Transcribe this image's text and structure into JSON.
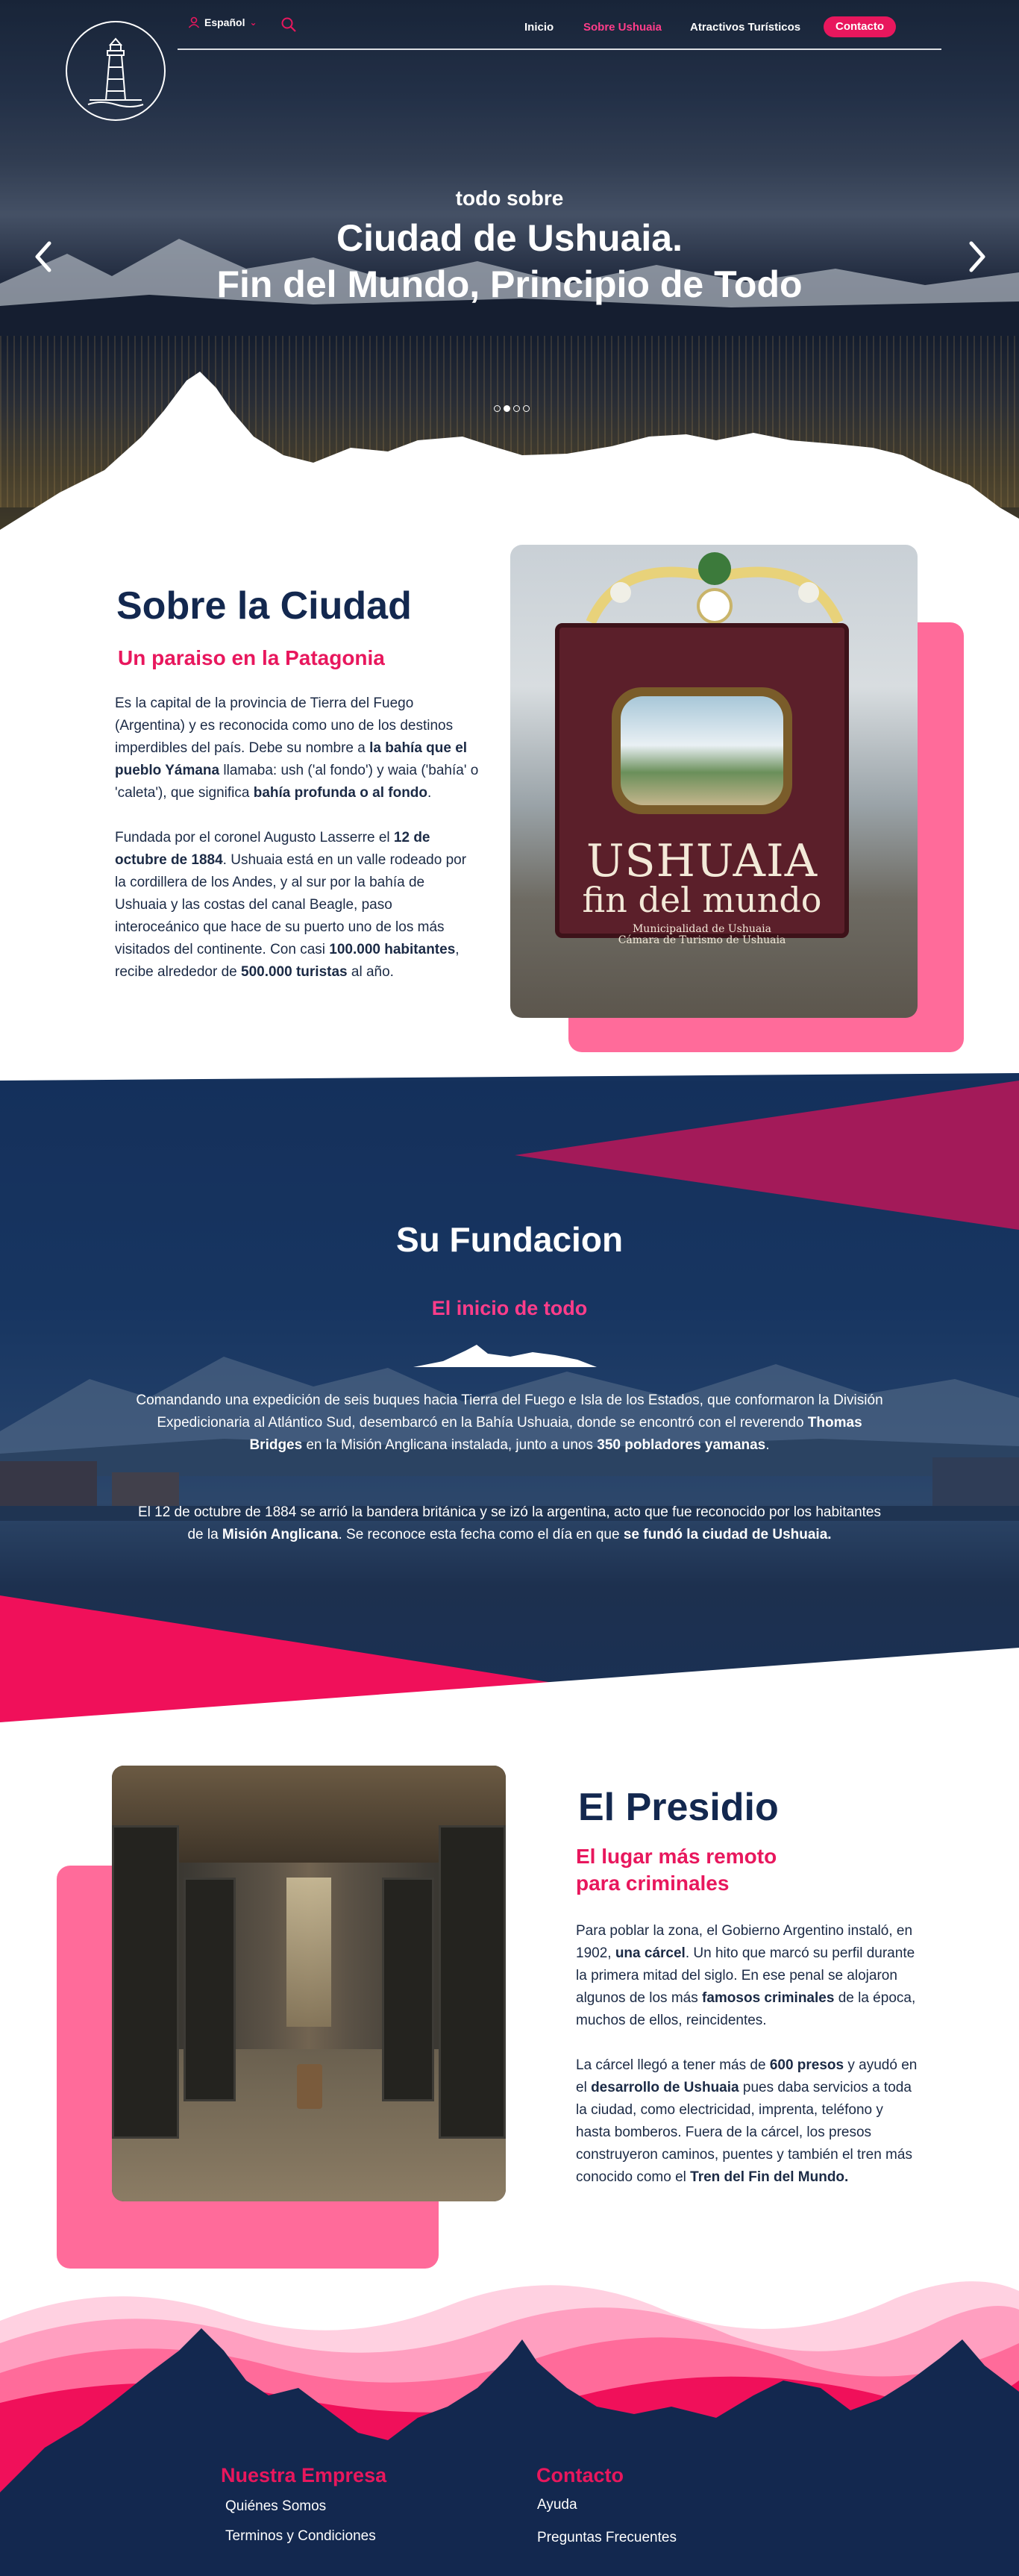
{
  "header": {
    "language": "Español",
    "nav": [
      "Inicio",
      "Sobre Ushuaia",
      "Atractivos Turísticos",
      "Contacto"
    ],
    "active_nav": "Sobre Ushuaia"
  },
  "hero": {
    "kicker": "todo sobre",
    "title_line1": "Ciudad de Ushuaia.",
    "title_line2": "Fin del Mundo, Principio de Todo",
    "slides": 4,
    "active_slide": 2
  },
  "sobre": {
    "title": "Sobre la Ciudad",
    "subtitle": "Un paraiso en la Patagonia",
    "p1": [
      {
        "t": "Es la capital de la provincia de Tierra del Fuego (Argentina) y es reconocida como uno de los destinos imperdibles del país. Debe su nombre a "
      },
      {
        "t": "la bahía que el pueblo Yámana",
        "b": true
      },
      {
        "t": " llamaba: ush ('al fondo') y waia ('bahía' o 'caleta'), que significa "
      },
      {
        "t": "bahía profunda o al fondo",
        "b": true
      },
      {
        "t": "."
      }
    ],
    "p2": [
      {
        "t": "Fundada por el coronel Augusto Lasserre el "
      },
      {
        "t": "12 de octubre de 1884",
        "b": true
      },
      {
        "t": ". Ushuaia está en un valle rodeado por la cordillera de los Andes, y al sur por la bahía de Ushuaia y las costas del canal Beagle, paso interoceánico que hace de su puerto uno de los más visitados del continente. Con casi "
      },
      {
        "t": "100.000 habitantes",
        "b": true
      },
      {
        "t": ", recibe alrededor de "
      },
      {
        "t": "500.000 turistas",
        "b": true
      },
      {
        "t": " al año."
      }
    ],
    "sign": {
      "word": "USHUAIA",
      "sub": "fin del mundo",
      "muni1": "Municipalidad de Ushuaia",
      "muni2": "Cámara de Turismo de Ushuaia"
    }
  },
  "fundacion": {
    "title": "Su Fundacion",
    "subtitle": "El inicio de todo",
    "p1": [
      {
        "t": "Comandando una expedición de seis buques hacia Tierra del Fuego e Isla de los Estados, que conformaron la División Expedicionaria al Atlántico Sud, desembarcó en la Bahía Ushuaia, donde se encontró con el reverendo "
      },
      {
        "t": "Thomas Bridges",
        "b": true
      },
      {
        "t": " en la Misión Anglicana instalada, junto a unos "
      },
      {
        "t": "350 pobladores yamanas",
        "b": true
      },
      {
        "t": "."
      }
    ],
    "p2": [
      {
        "t": "El 12 de octubre de 1884 se arrió la bandera británica y se izó la argentina, acto que fue reconocido por los habitantes de la "
      },
      {
        "t": "Misión Anglicana",
        "b": true
      },
      {
        "t": ". Se reconoce esta fecha como el día en que "
      },
      {
        "t": "se fundó la ciudad de Ushuaia.",
        "b": true
      }
    ]
  },
  "presidio": {
    "title": "El Presidio",
    "subtitle_line1": "El lugar más remoto",
    "subtitle_line2": "para criminales",
    "p1": [
      {
        "t": "Para poblar la zona, el Gobierno Argentino instaló, en 1902, "
      },
      {
        "t": "una cárcel",
        "b": true
      },
      {
        "t": ".   Un hito que marcó su perfil durante la primera mitad del siglo. En ese penal se alojaron algunos de los más "
      },
      {
        "t": "famosos criminales",
        "b": true
      },
      {
        "t": " de la época, muchos de ellos, reincidentes."
      }
    ],
    "p2": [
      {
        "t": "La cárcel llegó a tener más de "
      },
      {
        "t": "600 presos",
        "b": true
      },
      {
        "t": " y ayudó en el "
      },
      {
        "t": "desarrollo de Ushuaia",
        "b": true
      },
      {
        "t": " pues daba servicios a toda la ciudad, como electricidad, imprenta, teléfono y hasta bomberos. Fuera de la cárcel, los presos construyeron caminos, puentes y también el tren más conocido como el  "
      },
      {
        "t": "Tren del Fin del Mundo.",
        "b": true
      }
    ]
  },
  "footer": {
    "col1": {
      "title": "Nuestra Empresa",
      "links": [
        "Quiénes Somos",
        "Terminos y Condiciones"
      ]
    },
    "col2": {
      "title": "Contacto",
      "links": [
        "Ayuda",
        "Preguntas Frecuentes"
      ]
    }
  },
  "colors": {
    "navy": "#13284f",
    "pink": "#e8175d",
    "light_pink": "#ff6b9a"
  },
  "icons": [
    "lighthouse-logo-icon",
    "user-icon",
    "chevron-down-icon",
    "search-icon",
    "arrow-left-icon",
    "arrow-right-icon",
    "mountain-divider-icon"
  ]
}
